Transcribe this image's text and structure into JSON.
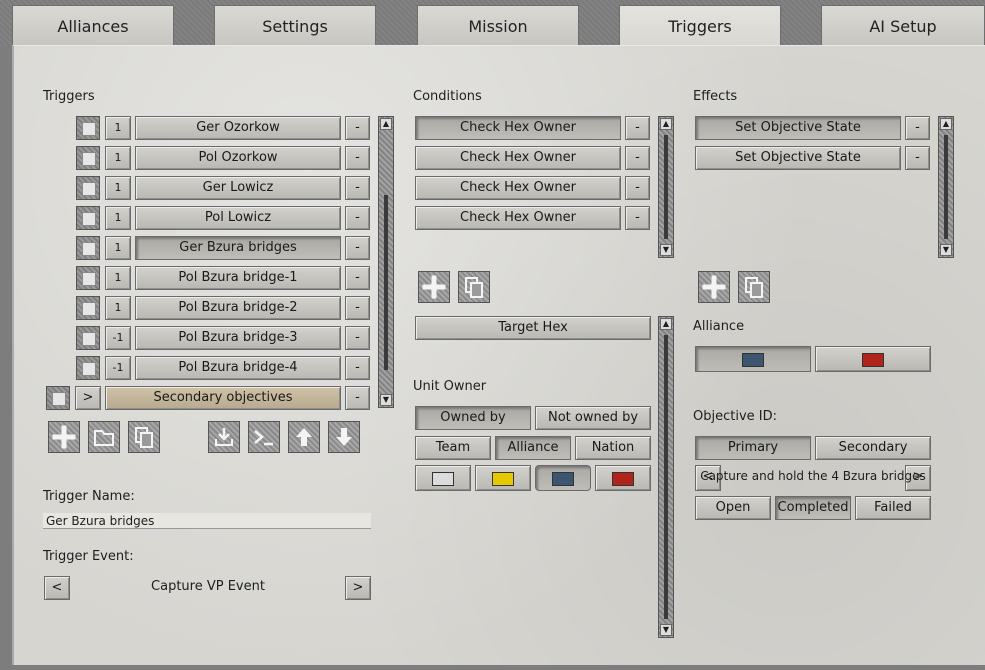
{
  "tabs": [
    "Alliances",
    "Settings",
    "Mission",
    "Triggers",
    "AI Setup"
  ],
  "active_tab": "Triggers",
  "triggers": {
    "header": "Triggers",
    "items": [
      {
        "count": "1",
        "label": "Ger Ozorkow"
      },
      {
        "count": "1",
        "label": "Pol Ozorkow"
      },
      {
        "count": "1",
        "label": "Ger Lowicz"
      },
      {
        "count": "1",
        "label": "Pol Lowicz"
      },
      {
        "count": "1",
        "label": "Ger Bzura bridges"
      },
      {
        "count": "1",
        "label": "Pol Bzura bridge-1"
      },
      {
        "count": "1",
        "label": "Pol Bzura bridge-2"
      },
      {
        "count": "-1",
        "label": "Pol Bzura bridge-3"
      },
      {
        "count": "-1",
        "label": "Pol Bzura bridge-4"
      }
    ],
    "group": {
      "expand": ">",
      "label": "Secondary objectives"
    },
    "remove_label": "-",
    "name_label": "Trigger Name:",
    "name_value": "Ger Bzura bridges",
    "event_label": "Trigger Event:",
    "event_value": "Capture VP Event",
    "prev": "<",
    "next": ">"
  },
  "conditions": {
    "header": "Conditions",
    "items": [
      "Check Hex Owner",
      "Check Hex Owner",
      "Check Hex Owner",
      "Check Hex Owner"
    ],
    "remove_label": "-",
    "target_hex": "Target Hex",
    "unit_owner_label": "Unit Owner",
    "owned_by": "Owned by",
    "not_owned_by": "Not owned by",
    "team": "Team",
    "alliance": "Alliance",
    "nation": "Nation",
    "colors": [
      "#dcdcdc",
      "#e8c800",
      "#3c5570",
      "#b0241c"
    ]
  },
  "effects": {
    "header": "Effects",
    "items": [
      "Set Objective State",
      "Set Objective State"
    ],
    "remove_label": "-",
    "alliance_label": "Alliance",
    "alliance_colors": [
      "#3c5570",
      "#b0241c"
    ],
    "objective_id_label": "Objective ID:",
    "primary": "Primary",
    "secondary": "Secondary",
    "objective_text": "Capture and hold the 4 Bzura bridges",
    "prev": "<",
    "next": ">",
    "open": "Open",
    "completed": "Completed",
    "failed": "Failed"
  }
}
